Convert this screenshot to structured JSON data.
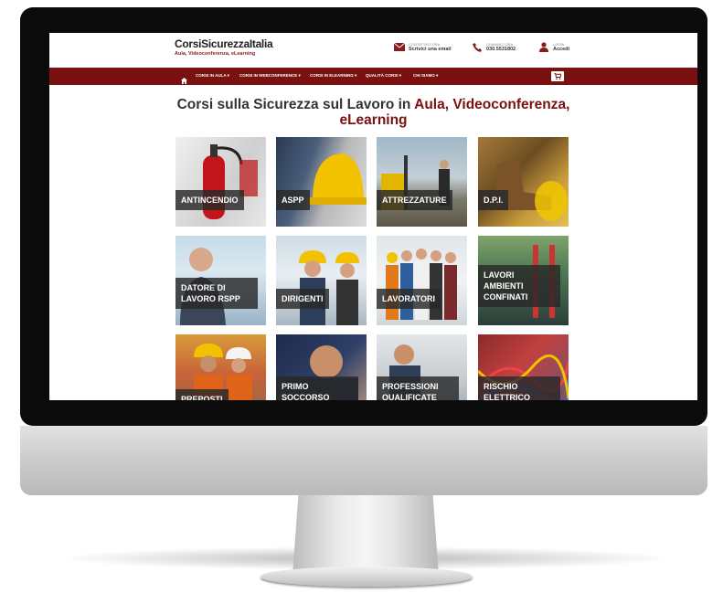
{
  "site": {
    "logo": {
      "name": "CorsiSicurezzaItalia",
      "tagline": "Aula, Videoconferenza, eLearning"
    },
    "contacts": [
      {
        "icon": "envelope-icon",
        "small": "CONTATTACI ORA",
        "big": "Scrivici una email"
      },
      {
        "icon": "phone-icon",
        "small": "CHIAMACI ORA",
        "big": "030.5531802"
      },
      {
        "icon": "user-icon",
        "small": "LOGIN",
        "big": "Accedi"
      }
    ],
    "nav": [
      "CORSI IN AULA ▾",
      "CORSI IN WEBCONFERENCE ▾",
      "CORSI IN ELEARNING ▾",
      "QUALITÀ CORSI ▾",
      "CHI SIAMO ▾"
    ],
    "heading": {
      "prefix": "Corsi sulla Sicurezza sul Lavoro in ",
      "highlight1": "Aula, Videoconferenza,",
      "highlight2": "eLearning"
    },
    "tiles": [
      "ANTINCENDIO",
      "ASPP",
      "ATTREZZATURE",
      "D.P.I.",
      "DATORE DI LAVORO RSPP",
      "DIRIGENTI",
      "LAVORATORI",
      "LAVORI AMBIENTI CONFINATI",
      "PREPOSTI",
      "PRIMO SOCCORSO",
      "PROFESSIONI QUALIFICATE",
      "RISCHIO ELETTRICO"
    ],
    "colors": {
      "brand": "#7a1010",
      "tag": "#8b1a1a"
    }
  }
}
